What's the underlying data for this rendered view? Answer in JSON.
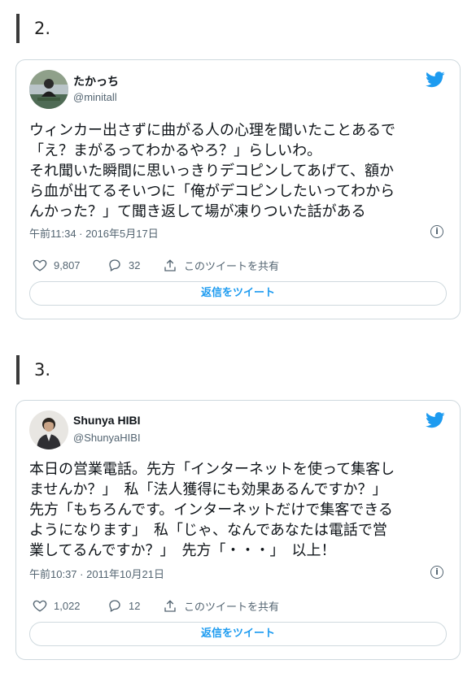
{
  "sections": [
    {
      "number": "2.",
      "tweet": {
        "display_name": "たかっち",
        "handle": "@minitall",
        "text": "ウィンカー出さずに曲がる人の心理を聞いたことあるで\n「え？まがるってわかるやろ？」らしいわ。\nそれ聞いた瞬間に思いっきりデコピンしてあげて、額か\nら血が出てるそいつに「俺がデコピンしたいってわから\nんかった？」て聞き返して場が凍りついた話がある",
        "timestamp": "午前11:34 · 2016年5月17日",
        "likes": "9,807",
        "replies": "32",
        "share_label": "このツイートを共有",
        "reply_button": "返信をツイート"
      }
    },
    {
      "number": "3.",
      "tweet": {
        "display_name": "Shunya HIBI",
        "handle": "@ShunyaHIBI",
        "text": "本日の営業電話。先方「インターネットを使って集客し\nませんか？」　私「法人獲得にも効果あるんですか？」\n先方「もちろんです。インターネットだけで集客できる\nようになります」　私「じゃ、なんであなたは電話で営\n業してるんですか？」　先方「・・・」　以上！",
        "timestamp": "午前10:37 · 2011年10月21日",
        "likes": "1,022",
        "replies": "12",
        "share_label": "このツイートを共有",
        "reply_button": "返信をツイート"
      }
    }
  ],
  "icons": {
    "brand": "twitter-bird-icon",
    "info": "info-icon",
    "like": "heart-icon",
    "reply": "reply-bubble-icon",
    "share": "share-icon"
  },
  "colors": {
    "accent": "#1d9bf0",
    "text": "#0f1419",
    "muted": "#536471",
    "border": "#cfd9de"
  }
}
